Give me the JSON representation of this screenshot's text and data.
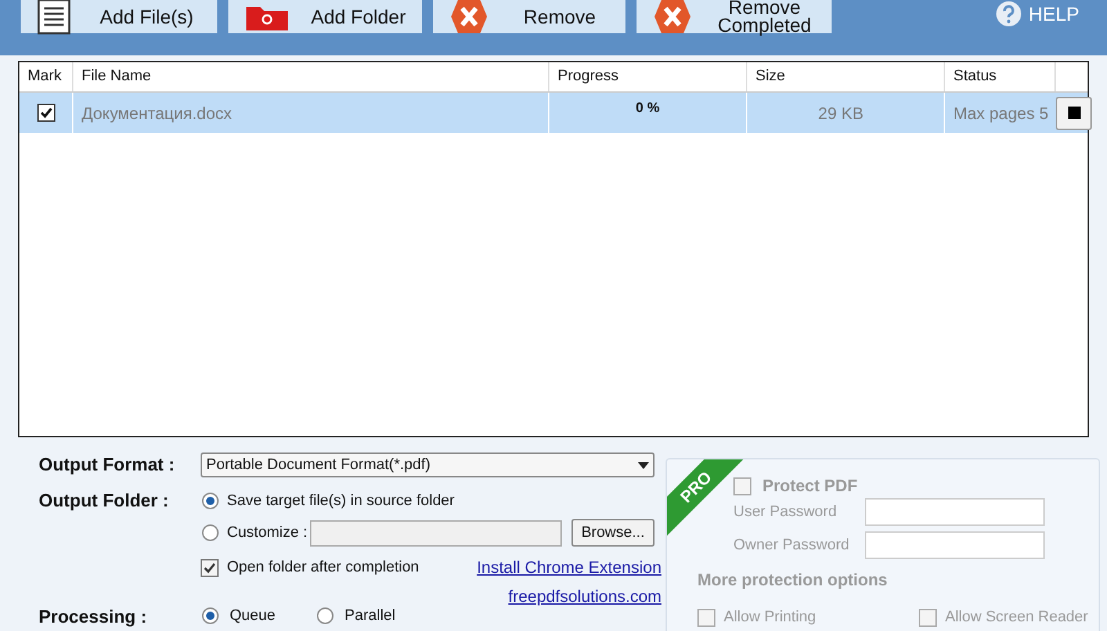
{
  "toolbar": {
    "buttons": [
      {
        "kind": "files",
        "label": "Add File(s)"
      },
      {
        "kind": "folder",
        "label": "Add Folder"
      },
      {
        "kind": "remove",
        "label": "Remove"
      },
      {
        "kind": "remove",
        "label": "Remove Completed"
      }
    ],
    "help": "HELP"
  },
  "table": {
    "columns": [
      "Mark",
      "File Name",
      "Progress",
      "Size",
      "Status"
    ],
    "rows": [
      {
        "checked": true,
        "file_name": "Документация.docx",
        "progress": "0 %",
        "size": "29 KB",
        "status": "Max pages 5",
        "selected": true
      }
    ]
  },
  "output_format": {
    "label": "Output Format :",
    "value": "Portable Document Format(*.pdf)"
  },
  "output_folder": {
    "label": "Output Folder :",
    "options": [
      {
        "label": "Save target file(s) in source folder",
        "selected": true
      },
      {
        "label": "Customize :",
        "selected": false
      }
    ],
    "browse": "Browse...",
    "open_after": {
      "label": "Open folder after completion",
      "checked": true
    }
  },
  "links": [
    "Install Chrome Extension",
    "freepdfsolutions.com"
  ],
  "processing": {
    "label": "Processing :",
    "options": [
      {
        "label": "Queue",
        "selected": true
      },
      {
        "label": "Parallel",
        "selected": false
      }
    ]
  },
  "protect": {
    "badge": "PRO",
    "label": "Protect PDF",
    "checked": false,
    "user_password": "User Password",
    "owner_password": "Owner Password",
    "more": "More protection options",
    "options": [
      {
        "label": "Allow Printing",
        "checked": false
      },
      {
        "label": "Allow Screen Reader",
        "checked": false
      }
    ]
  }
}
